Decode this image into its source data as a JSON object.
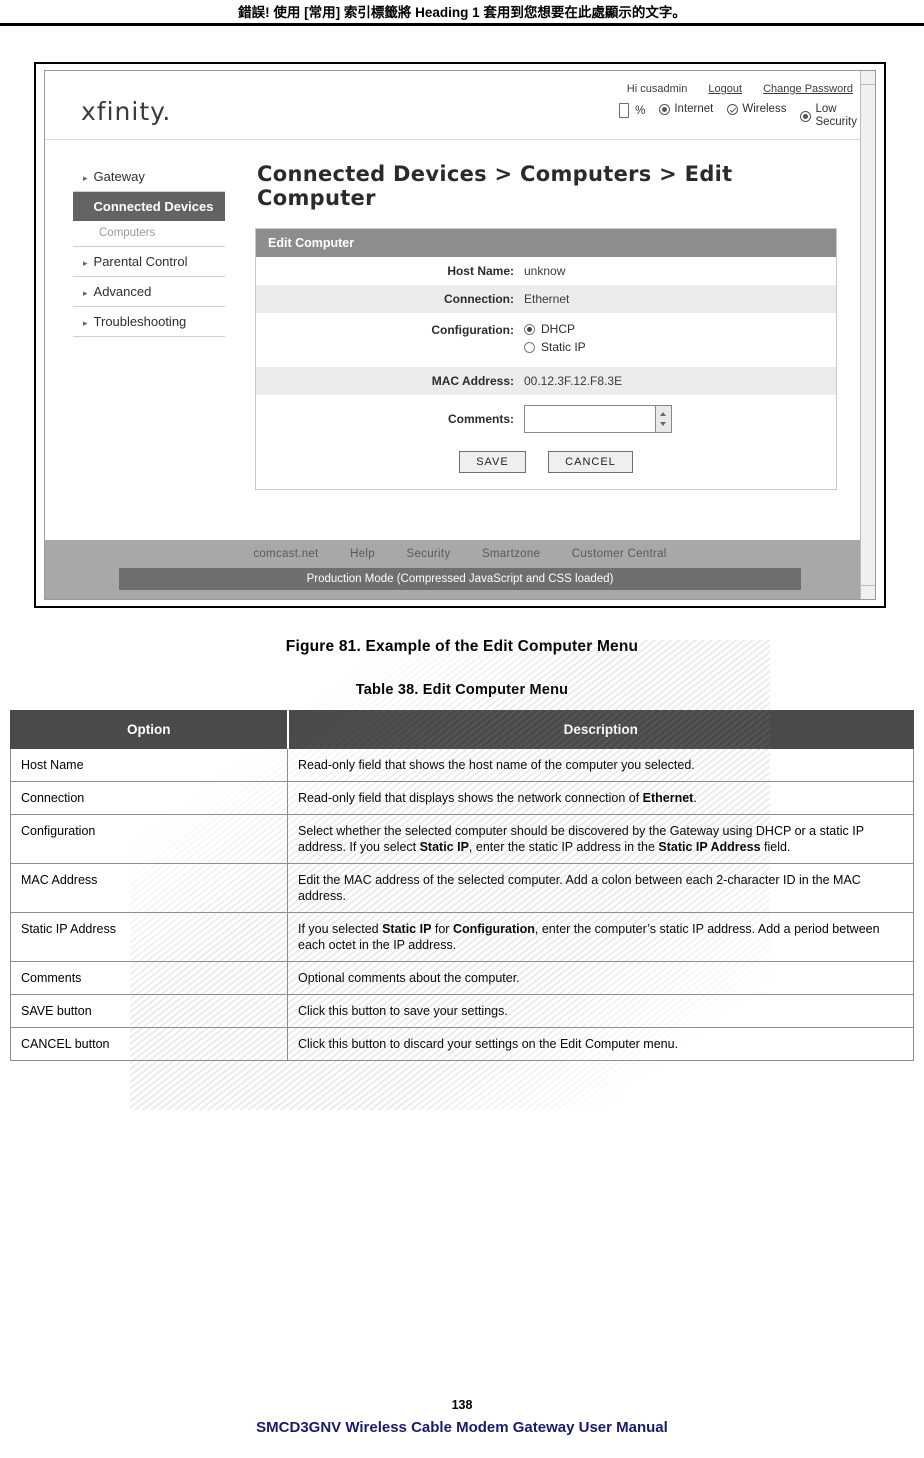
{
  "header": {
    "error_line": "錯誤! 使用 [常用] 索引標籤將 Heading 1 套用到您想要在此處顯示的文字。"
  },
  "screenshot": {
    "logo": "xfinity.",
    "top_links": {
      "greeting": "Hi cusadmin",
      "logout": "Logout",
      "change_password": "Change Password"
    },
    "status": {
      "battery_pct": "%",
      "internet": "Internet",
      "wireless": "Wireless",
      "security_line1": "Low",
      "security_line2": "Security"
    },
    "sidebar": [
      {
        "label": "Gateway",
        "caret": "▸",
        "active": false
      },
      {
        "label": "Connected Devices",
        "caret": "▾",
        "active": true
      },
      {
        "label": "Computers",
        "sub": true
      },
      {
        "label": "Parental Control",
        "caret": "▸",
        "active": false
      },
      {
        "label": "Advanced",
        "caret": "▸",
        "active": false
      },
      {
        "label": "Troubleshooting",
        "caret": "▸",
        "active": false
      }
    ],
    "page_title": "Connected Devices > Computers > Edit Computer",
    "panel": {
      "head": "Edit Computer",
      "rows": {
        "host_name_label": "Host Name:",
        "host_name_value": "unknow",
        "connection_label": "Connection:",
        "connection_value": "Ethernet",
        "configuration_label": "Configuration:",
        "configuration_dhcp": "DHCP",
        "configuration_static": "Static IP",
        "mac_label": "MAC Address:",
        "mac_value": "00.12.3F.12.F8.3E",
        "comments_label": "Comments:",
        "comments_value": ""
      },
      "save_button": "SAVE",
      "cancel_button": "CANCEL"
    },
    "footer_links": [
      "comcast.net",
      "Help",
      "Security",
      "Smartzone",
      "Customer Central"
    ],
    "production_bar": "Production Mode (Compressed JavaScript and CSS loaded)"
  },
  "figure_caption": "Figure 81. Example of the Edit Computer Menu",
  "table_caption": "Table 38. Edit Computer Menu",
  "table": {
    "columns": [
      "Option",
      "Description"
    ],
    "rows": [
      {
        "option": "Host Name",
        "desc_html": "Read-only field that shows the host name of the computer you selected."
      },
      {
        "option": "Connection",
        "desc_html": "Read-only field that displays shows the network connection of <b>Ethernet</b>."
      },
      {
        "option": "Configuration",
        "desc_html": "Select whether the selected computer should be discovered by the Gateway using DHCP or a static IP address. If you select <b>Static IP</b>, enter the static IP address in the <b>Static IP Address</b> field."
      },
      {
        "option": "MAC Address",
        "desc_html": "Edit the MAC address of the selected computer. Add a colon between each 2-character ID in the MAC address."
      },
      {
        "option": "Static IP Address",
        "desc_html": "If you selected <b>Static IP</b> for <b>Configuration</b>, enter the computer’s static IP address. Add a period between each octet in the IP address."
      },
      {
        "option": "Comments",
        "desc_html": "Optional comments about the computer."
      },
      {
        "option": "SAVE button",
        "desc_html": "Click this button to save your settings."
      },
      {
        "option": "CANCEL button",
        "desc_html": "Click this button to discard your settings on the Edit Computer menu."
      }
    ]
  },
  "page_footer": {
    "page_number": "138",
    "manual_title": "SMCD3GNV Wireless Cable Modem Gateway User Manual"
  }
}
